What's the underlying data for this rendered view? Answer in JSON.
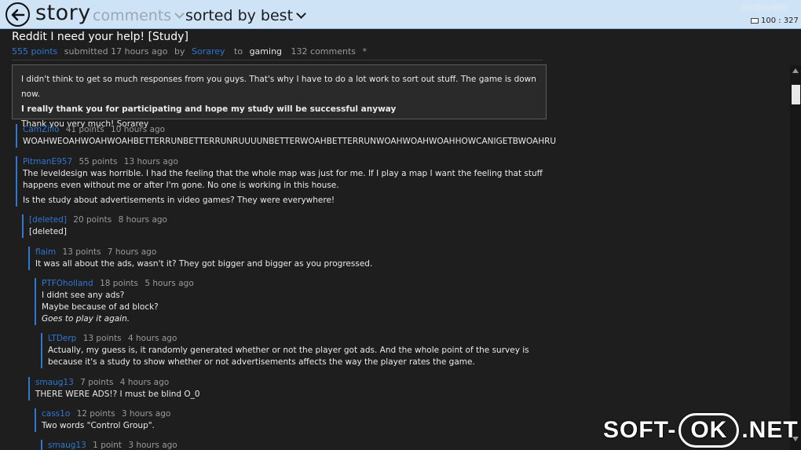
{
  "header": {
    "title": "story",
    "view": "comments",
    "sort": "sorted by best",
    "user": "kurtbrowni",
    "stats": "100 : 327"
  },
  "post": {
    "title": "Reddit I need your help! [Study]",
    "points": "555 points",
    "submitted": "submitted 17 hours ago",
    "by": "by",
    "author": "Sorarey",
    "to": "to",
    "subreddit": "gaming",
    "comments": "132 comments",
    "star": "*",
    "selftext": [
      "I didn't think to get so much responses from you guys. That's why I have to do a lot work to sort out stuff. The game is down now.",
      "I really thank you for participating and hope my study will be successful anyway",
      "Thank you very much! Sorarey"
    ]
  },
  "comments": [
    {
      "author": "CamZillo",
      "points": "41 points",
      "age": "10 hours ago",
      "body": [
        "WOAHWEOAHWOAHWOAHBETTERRUNBETTERRUNRUUUUNBETTERWOAHBETTERRUNWOAHWOAHWOAHHOWCANIGETBWOAHRU"
      ]
    },
    {
      "author": "PitmanE957",
      "points": "55 points",
      "age": "13 hours ago",
      "body": [
        "The leveldesign was horrible. I had the feeling that the whole map was just for me. If I play a map I want the feeling that stuff happens even without me or after I'm gone. No one is working in this house.",
        "Is the study about advertisements in video games? They were everywhere!"
      ]
    },
    {
      "author": "[deleted]",
      "points": "20 points",
      "age": "8 hours ago",
      "body": [
        "[deleted]"
      ]
    },
    {
      "author": "flaim",
      "points": "13 points",
      "age": "7 hours ago",
      "body": [
        "It was all about the ads, wasn't it? They got bigger and bigger as you progressed."
      ]
    },
    {
      "author": "PTFOholland",
      "points": "18 points",
      "age": "5 hours ago",
      "body": [
        "I didnt see any ads?",
        "Maybe because of ad block?",
        "Goes to play it again."
      ]
    },
    {
      "author": "LTDerp",
      "points": "13 points",
      "age": "4 hours ago",
      "body": [
        "Actually, my guess is, it randomly generated whether or not the player got ads. And the whole point of the survey is because it's a study to show whether or not advertisements affects the way the player rates the game."
      ]
    },
    {
      "author": "smaug13",
      "points": "7 points",
      "age": "4 hours ago",
      "body": [
        "THERE WERE ADS!? I must be blind O_0"
      ]
    },
    {
      "author": "cass1o",
      "points": "12 points",
      "age": "3 hours ago",
      "body": [
        "Two words \"Control Group\"."
      ]
    },
    {
      "author": "smaug13",
      "points": "1 point",
      "age": "3 hours ago",
      "body": []
    }
  ],
  "watermark": {
    "left": "SOFT-",
    "mid": "OK",
    "right": ".NET"
  },
  "colors": {
    "accent": "#2f77d1",
    "header_bg": "#cfe3f6",
    "page_bg": "#1e1e1e"
  },
  "icons": {
    "back": "back-arrow-icon",
    "sort": "chevron-down-icon",
    "mail": "mail-icon"
  }
}
